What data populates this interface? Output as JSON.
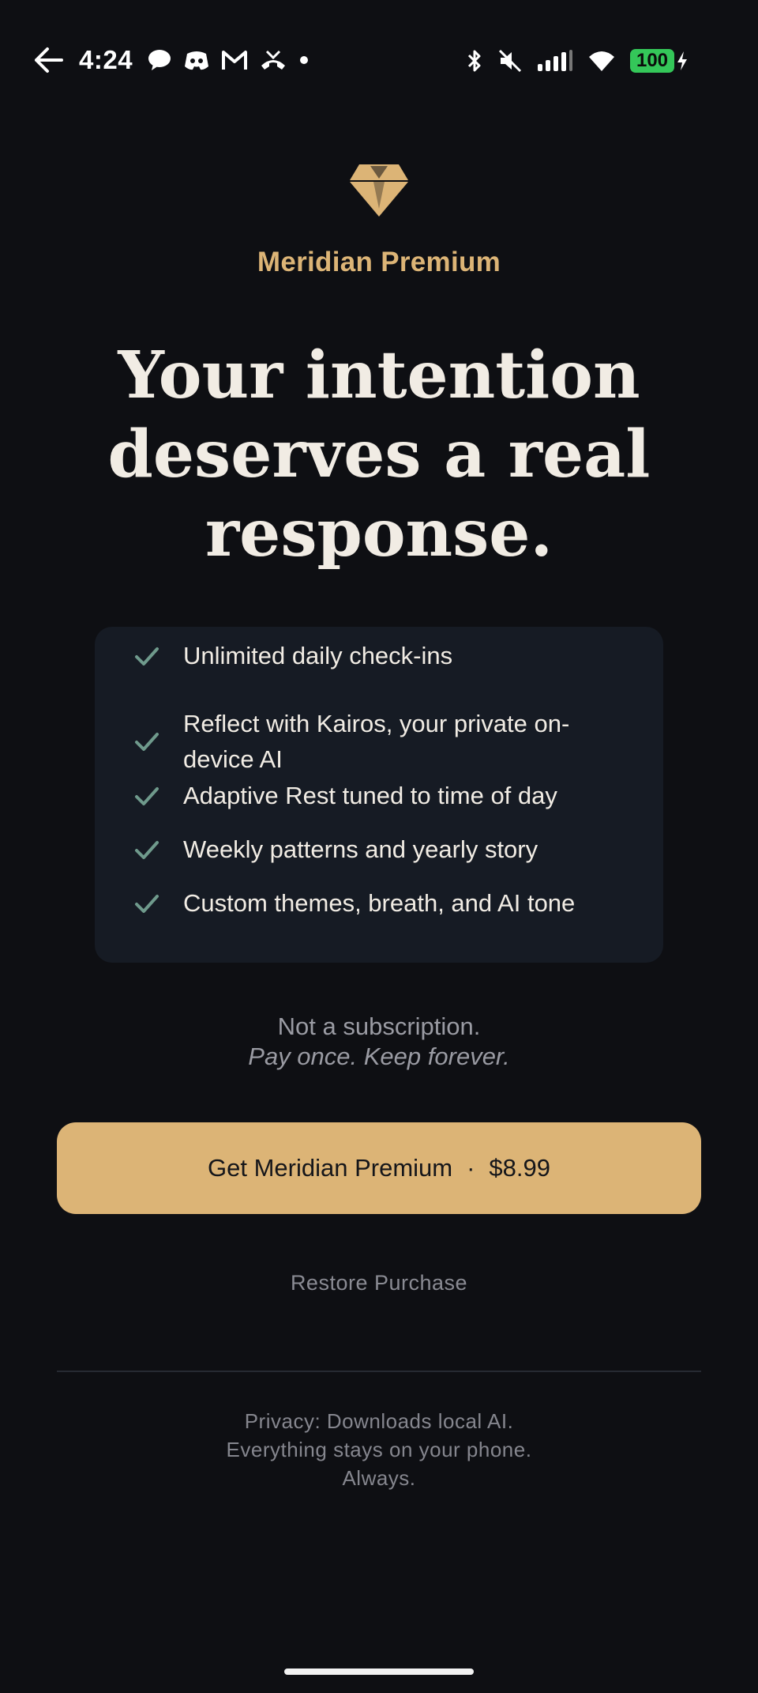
{
  "status_bar": {
    "time": "4:24",
    "battery": "100",
    "icons": [
      "back-arrow-icon",
      "chat-bubble-icon",
      "discord-icon",
      "gmail-icon",
      "missed-call-icon",
      "dot-icon",
      "bluetooth-icon",
      "mute-icon",
      "signal-icon",
      "wifi-icon",
      "battery-icon",
      "charging-icon"
    ]
  },
  "header": {
    "icon": "diamond-icon",
    "brand": "Meridian Premium",
    "headline": [
      "Your intention",
      "deserves a real",
      "response."
    ]
  },
  "features": [
    {
      "label": "Unlimited daily check-ins"
    },
    {
      "label": "Reflect with Kairos, your private on-device AI"
    },
    {
      "label": "Adaptive Rest tuned to time of day"
    },
    {
      "label": "Weekly patterns and yearly story"
    },
    {
      "label": "Custom themes, breath, and AI tone"
    }
  ],
  "pitch": {
    "line1": "Not a subscription.",
    "line2": "Pay once. Keep forever."
  },
  "cta": {
    "label": "Get Meridian Premium",
    "separator": "·",
    "price": "$8.99"
  },
  "restore": "Restore Purchase",
  "privacy": [
    "Privacy: Downloads local AI.",
    "Everything stays on your phone.",
    "Always."
  ],
  "colors": {
    "background": "#0e0f13",
    "accent_gold": "#dcb476",
    "card": "#161b24",
    "check": "#6f9a8c",
    "battery": "#34c759"
  }
}
